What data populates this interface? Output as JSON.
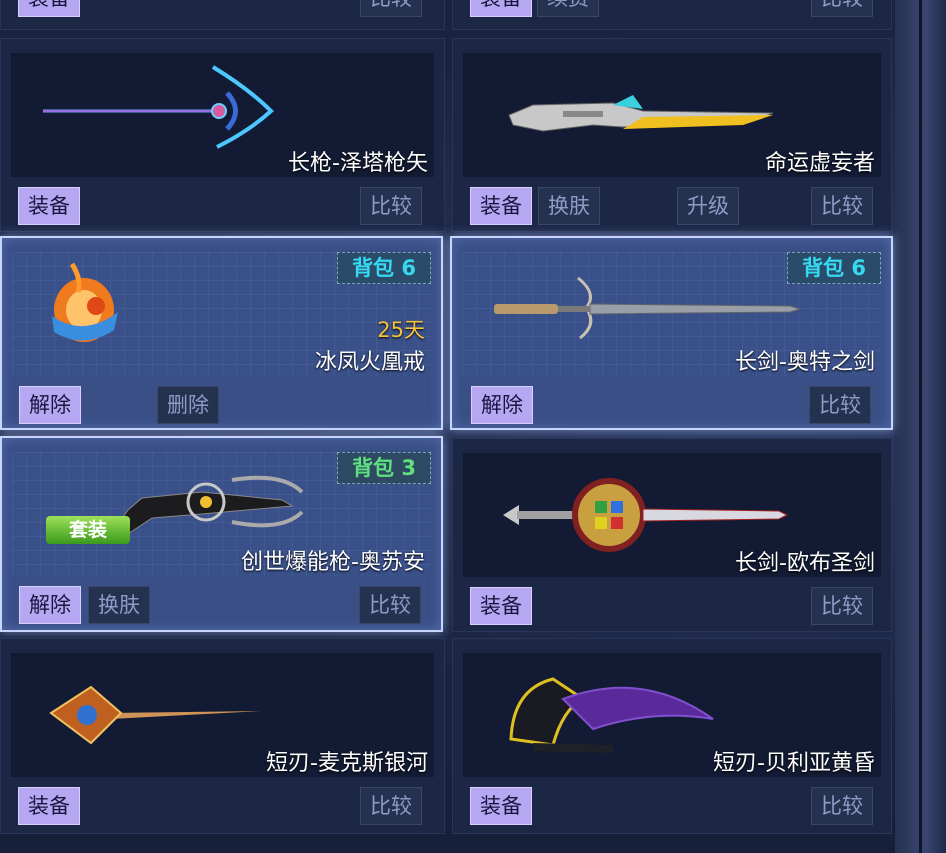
{
  "cards": [
    {
      "name": "",
      "buttons": [
        "装备",
        "比较"
      ]
    },
    {
      "name": "",
      "buttons": [
        "装备",
        "续费",
        "比较"
      ]
    },
    {
      "name": "长枪-泽塔枪矢",
      "buttons": [
        "装备",
        "比较"
      ]
    },
    {
      "name": "命运虚妄者",
      "buttons": [
        "装备",
        "换肤",
        "升级",
        "比较"
      ]
    },
    {
      "name": "冰凤火凰戒",
      "days": "25天",
      "badge": "背包 6",
      "buttons": [
        "解除",
        "删除"
      ]
    },
    {
      "name": "长剑-奥特之剑",
      "badge": "背包 6",
      "buttons": [
        "解除",
        "比较"
      ]
    },
    {
      "name": "创世爆能枪-奥苏安",
      "badge": "背包 3",
      "tag": "套装",
      "buttons": [
        "解除",
        "换肤",
        "比较"
      ]
    },
    {
      "name": "长剑-欧布圣剑",
      "buttons": [
        "装备",
        "比较"
      ]
    },
    {
      "name": "短刃-麦克斯银河",
      "buttons": [
        "装备",
        "比较"
      ]
    },
    {
      "name": "短刃-贝利亚黄昏",
      "buttons": [
        "装备",
        "比较"
      ]
    }
  ],
  "colors": {
    "primary_button": "#b6a7f2",
    "badge_cyan": "#35d9f0",
    "badge_green": "#5fe07f",
    "days": "#f4c33a",
    "selected_border": "#c8d6ff"
  }
}
